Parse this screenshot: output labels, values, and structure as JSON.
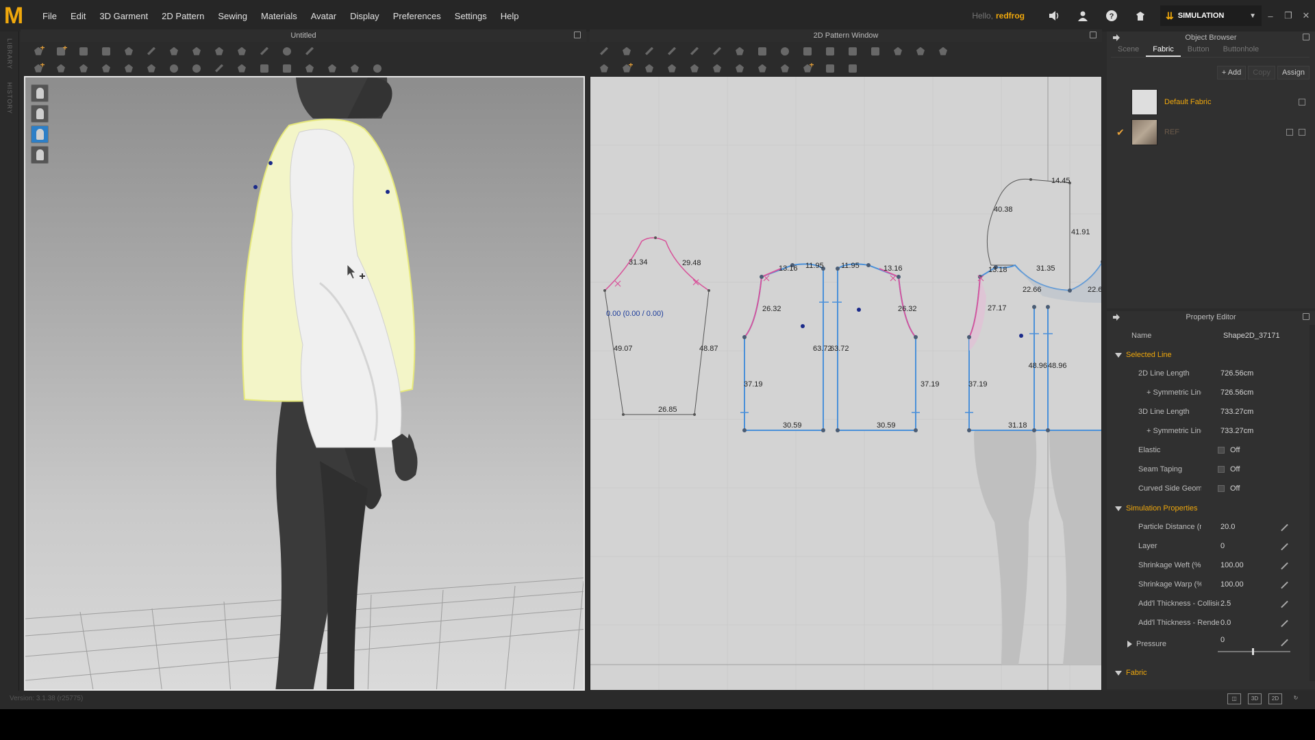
{
  "app": {
    "logo": "M"
  },
  "menu": [
    "File",
    "Edit",
    "3D Garment",
    "2D Pattern",
    "Sewing",
    "Materials",
    "Avatar",
    "Display",
    "Preferences",
    "Settings",
    "Help"
  ],
  "user": {
    "hello": "Hello,",
    "name": "redfrog"
  },
  "mode": {
    "label": "SIMULATION"
  },
  "side_tabs": {
    "library": "LIBRARY",
    "history": "HISTORY"
  },
  "view3d": {
    "title": "Untitled"
  },
  "view2d": {
    "title": "2D Pattern Window",
    "sleeve_center_label": "0.00 (0.00 / 0.00)",
    "measurements": {
      "sleeve": [
        "31.34",
        "29.48",
        "49.07",
        "48.87",
        "26.85"
      ],
      "front_left": [
        "13.16",
        "11.95",
        "26.32",
        "63.72",
        "37.19",
        "30.59"
      ],
      "front_right": [
        "11.95",
        "13.16",
        "26.32",
        "63.72",
        "37.19",
        "30.59"
      ],
      "collar": [
        "14.45",
        "40.38",
        "41.91"
      ],
      "back": [
        "13.18",
        "31.35",
        "22.66",
        "22.6",
        "27.17",
        "37.19",
        "48.96",
        "48.96",
        "31.18"
      ]
    }
  },
  "object_browser": {
    "title": "Object Browser",
    "tabs": [
      "Scene",
      "Fabric",
      "Button",
      "Buttonhole"
    ],
    "active_tab": "Fabric",
    "actions": [
      "+ Add",
      "Copy",
      "Assign"
    ],
    "fabrics": [
      {
        "name": "Default Fabric",
        "checked": false,
        "color": "#f0a80c"
      },
      {
        "name": "REF",
        "checked": true,
        "color": "#6b5a4a"
      }
    ]
  },
  "property_editor": {
    "title": "Property Editor",
    "name_label": "Name",
    "name_value": "Shape2D_37171",
    "sections": {
      "selected_line": "Selected Line",
      "simulation": "Simulation Properties",
      "fabric": "Fabric"
    },
    "selected_line": [
      {
        "label": "2D Line Length",
        "value": "726.56cm"
      },
      {
        "label": "+ Symmetric Line Le",
        "value": "726.56cm"
      },
      {
        "label": "3D Line Length",
        "value": "733.27cm"
      },
      {
        "label": "+ Symmetric Line Le",
        "value": "733.27cm"
      },
      {
        "label": "Elastic",
        "value": "Off"
      },
      {
        "label": "Seam Taping",
        "value": "Off"
      },
      {
        "label": "Curved Side Geome",
        "value": "Off"
      }
    ],
    "simulation": [
      {
        "label": "Particle Distance (m",
        "value": "20.0"
      },
      {
        "label": "Layer",
        "value": "0"
      },
      {
        "label": "Shrinkage Weft (%",
        "value": "100.00"
      },
      {
        "label": "Shrinkage Warp (%",
        "value": "100.00"
      },
      {
        "label": "Add'l Thickness - Collisio",
        "value": "2.5"
      },
      {
        "label": "Add'l Thickness - Render",
        "value": "0.0"
      }
    ],
    "pressure": {
      "label": "Pressure",
      "value": "0"
    }
  },
  "status": {
    "version": "Version: 3.1.38 (r25775)"
  },
  "colors": {
    "accent": "#f0a80c",
    "selected_blue": "#4a90d9",
    "seam_pink": "#d9529a"
  }
}
